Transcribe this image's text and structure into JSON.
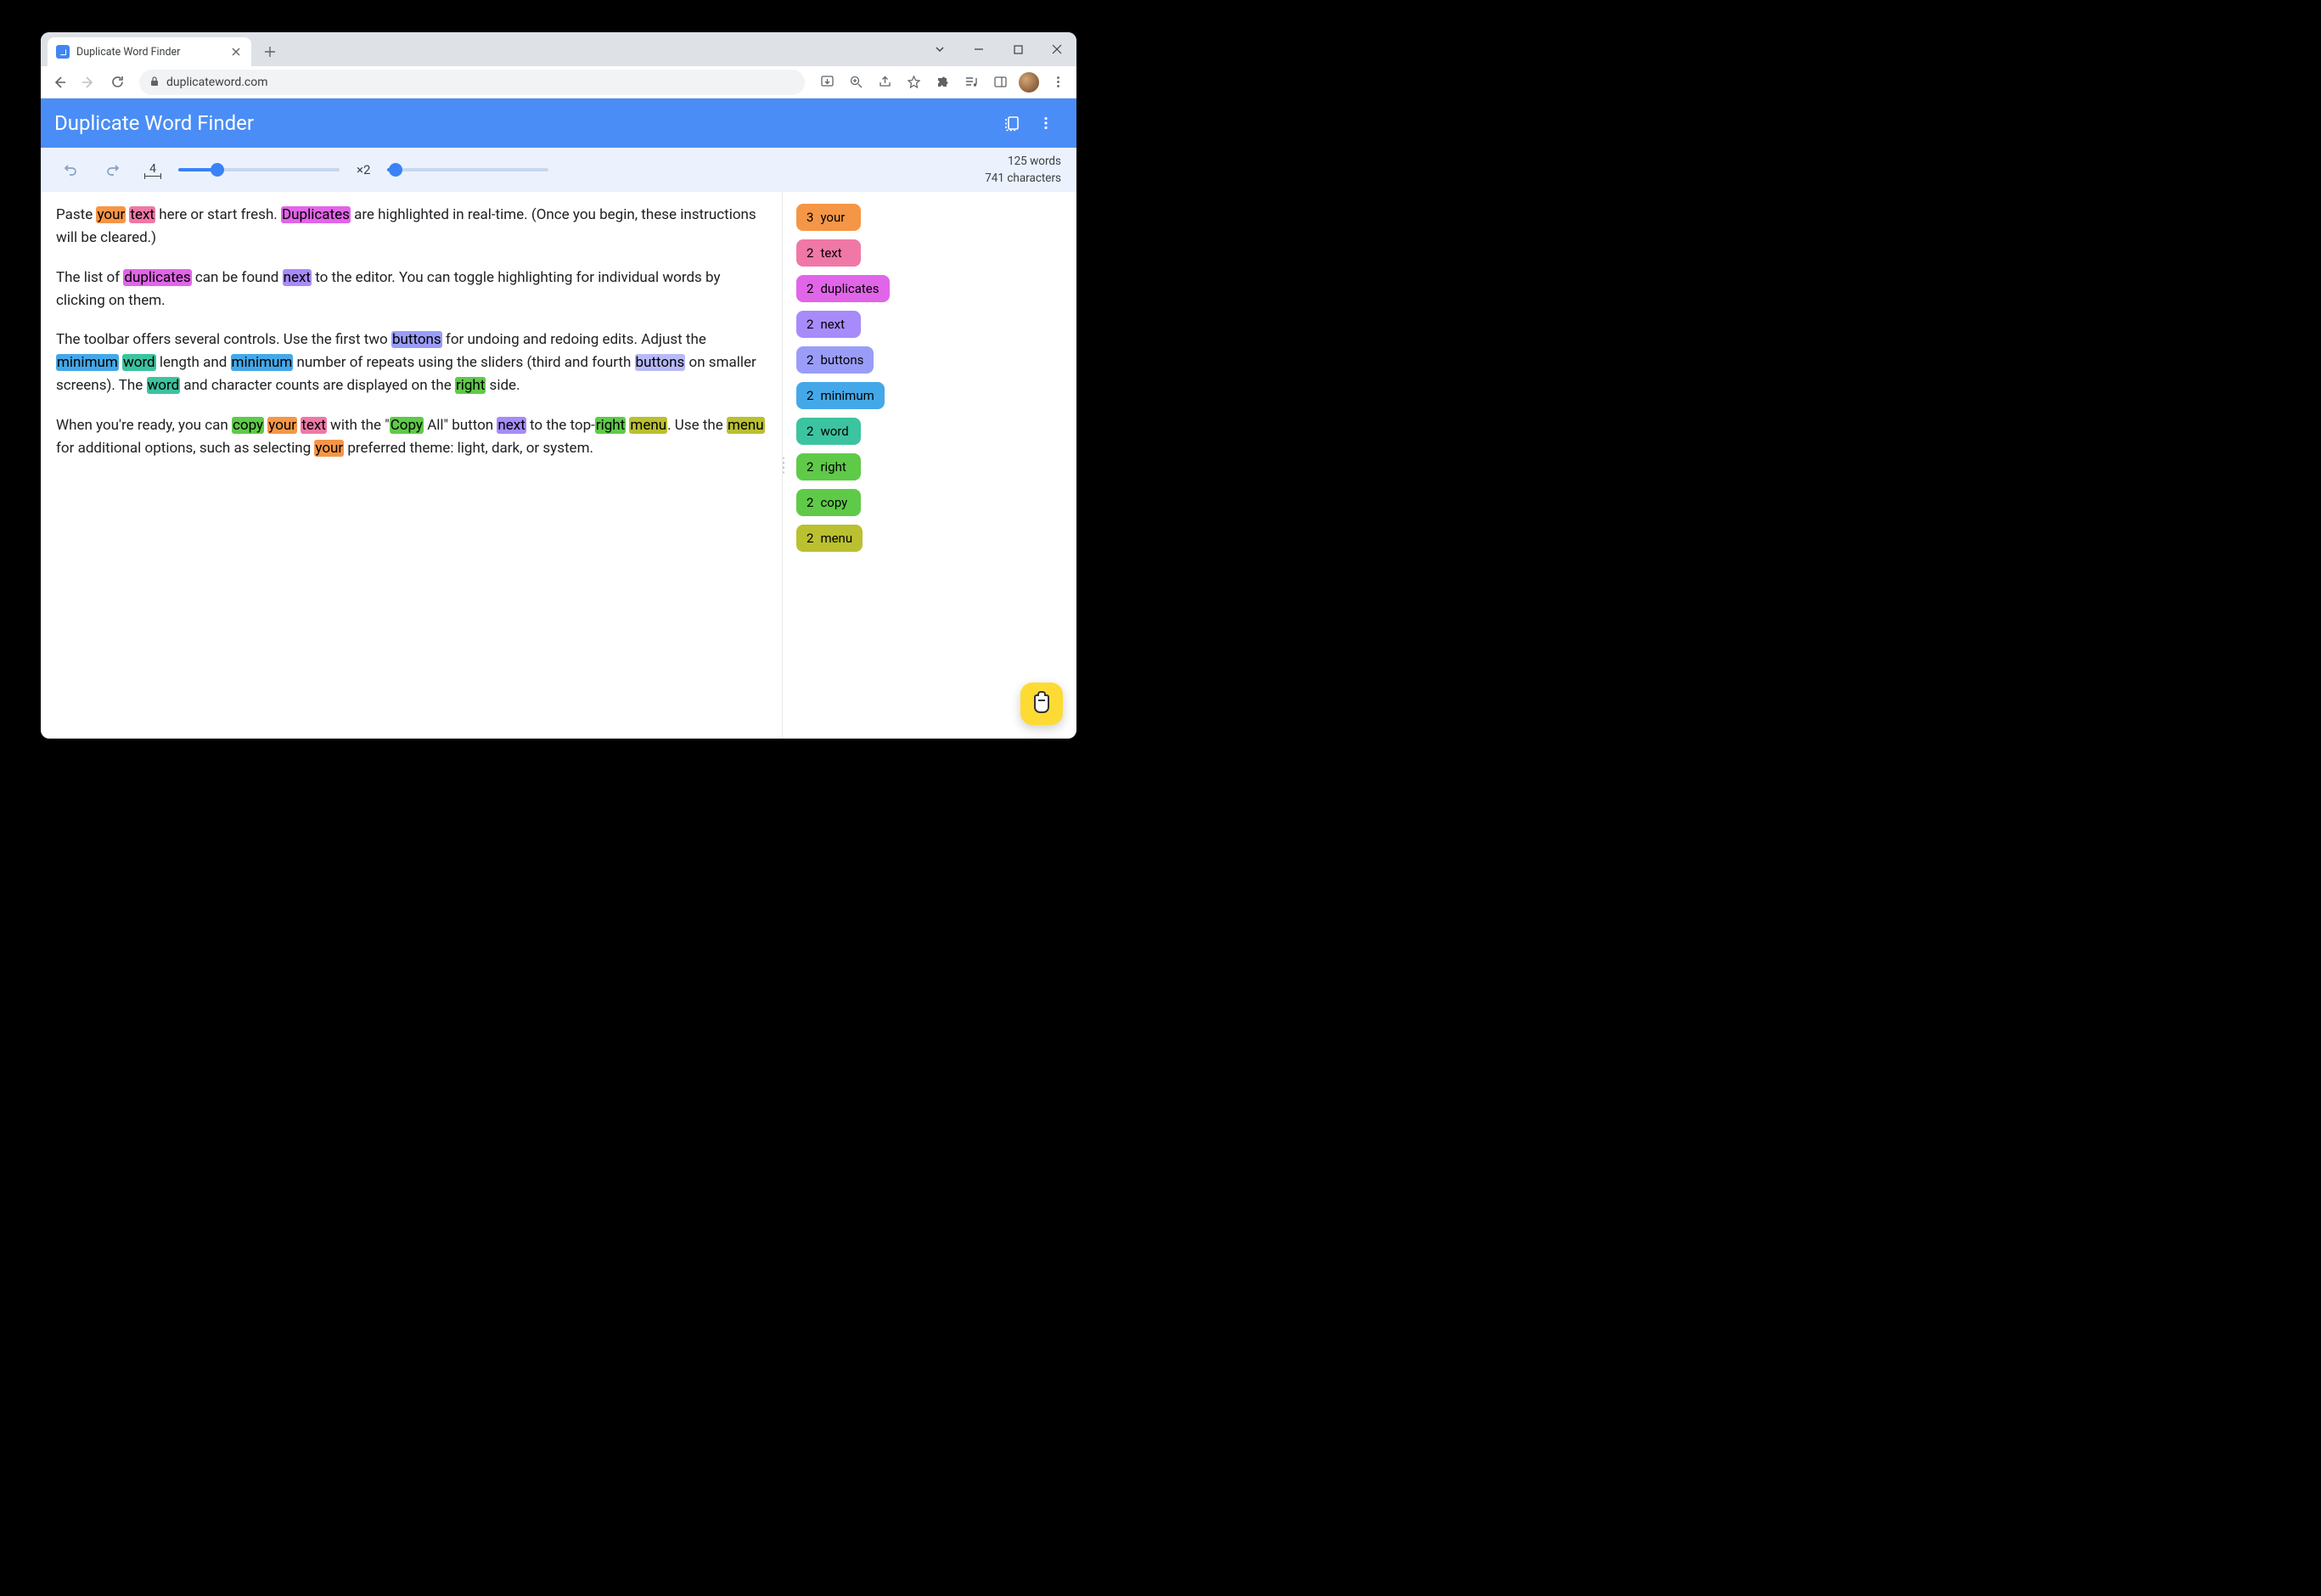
{
  "browser": {
    "tab_title": "Duplicate Word Finder",
    "url": "duplicateword.com"
  },
  "app": {
    "title": "Duplicate Word Finder"
  },
  "toolbar": {
    "min_length_value": "4",
    "min_length_slider_pct": 24,
    "repeat_label": "×2",
    "repeat_slider_pct": 5,
    "word_count": "125 words",
    "char_count": "741 characters"
  },
  "colors": {
    "your": "c-orange",
    "text": "c-pink",
    "duplicates": "c-magenta",
    "next": "c-violet",
    "buttons": "c-lavender",
    "minimum": "c-blue",
    "word": "c-teal",
    "right": "c-green",
    "copy": "c-green",
    "menu": "c-lime"
  },
  "editor": [
    [
      {
        "t": "Paste "
      },
      {
        "t": "your",
        "w": "your"
      },
      {
        "t": " "
      },
      {
        "t": "text",
        "w": "text"
      },
      {
        "t": " here or start fresh. "
      },
      {
        "t": "Duplicates",
        "w": "duplicates"
      },
      {
        "t": " are highlighted in real-time. (Once you begin, these instructions will be cleared.)"
      }
    ],
    [
      {
        "t": "The list of "
      },
      {
        "t": "duplicates",
        "w": "duplicates"
      },
      {
        "t": " can be found "
      },
      {
        "t": "next",
        "w": "next"
      },
      {
        "t": " to the editor. You can toggle highlighting for individual words by clicking on them."
      }
    ],
    [
      {
        "t": "The toolbar offers several controls. Use the first two "
      },
      {
        "t": "buttons",
        "w": "buttons"
      },
      {
        "t": " for undoing and redoing edits. Adjust the "
      },
      {
        "t": "minimum",
        "w": "minimum"
      },
      {
        "t": " "
      },
      {
        "t": "word",
        "w": "word"
      },
      {
        "t": " length and "
      },
      {
        "t": "minimum",
        "w": "minimum"
      },
      {
        "t": " number of repeats using the sliders (third and fourth "
      },
      {
        "t": "buttons",
        "w": "buttons",
        "c": "c-dimlavender"
      },
      {
        "t": " on smaller screens). The "
      },
      {
        "t": "word",
        "w": "word"
      },
      {
        "t": " and character counts are displayed on the "
      },
      {
        "t": "right",
        "w": "right"
      },
      {
        "t": " side."
      }
    ],
    [
      {
        "t": "When you're ready, you can "
      },
      {
        "t": "copy",
        "w": "copy"
      },
      {
        "t": " "
      },
      {
        "t": "your",
        "w": "your"
      },
      {
        "t": " "
      },
      {
        "t": "text",
        "w": "text"
      },
      {
        "t": " with the \""
      },
      {
        "t": "Copy",
        "w": "copy"
      },
      {
        "t": " All\" button "
      },
      {
        "t": "next",
        "w": "next"
      },
      {
        "t": " to the top-"
      },
      {
        "t": "right",
        "w": "right"
      },
      {
        "t": " "
      },
      {
        "t": "menu",
        "w": "menu"
      },
      {
        "t": ". Use the "
      },
      {
        "t": "menu",
        "w": "menu"
      },
      {
        "t": " for additional options, such as selecting "
      },
      {
        "t": "your",
        "w": "your"
      },
      {
        "t": " preferred theme: light, dark, or system."
      }
    ]
  ],
  "duplicates": [
    {
      "count": 3,
      "word": "your",
      "color": "c-orange"
    },
    {
      "count": 2,
      "word": "text",
      "color": "c-pink"
    },
    {
      "count": 2,
      "word": "duplicates",
      "color": "c-magenta"
    },
    {
      "count": 2,
      "word": "next",
      "color": "c-violet"
    },
    {
      "count": 2,
      "word": "buttons",
      "color": "c-lavender"
    },
    {
      "count": 2,
      "word": "minimum",
      "color": "c-blue"
    },
    {
      "count": 2,
      "word": "word",
      "color": "c-teal"
    },
    {
      "count": 2,
      "word": "right",
      "color": "c-green"
    },
    {
      "count": 2,
      "word": "copy",
      "color": "c-green"
    },
    {
      "count": 2,
      "word": "menu",
      "color": "c-lime"
    }
  ]
}
